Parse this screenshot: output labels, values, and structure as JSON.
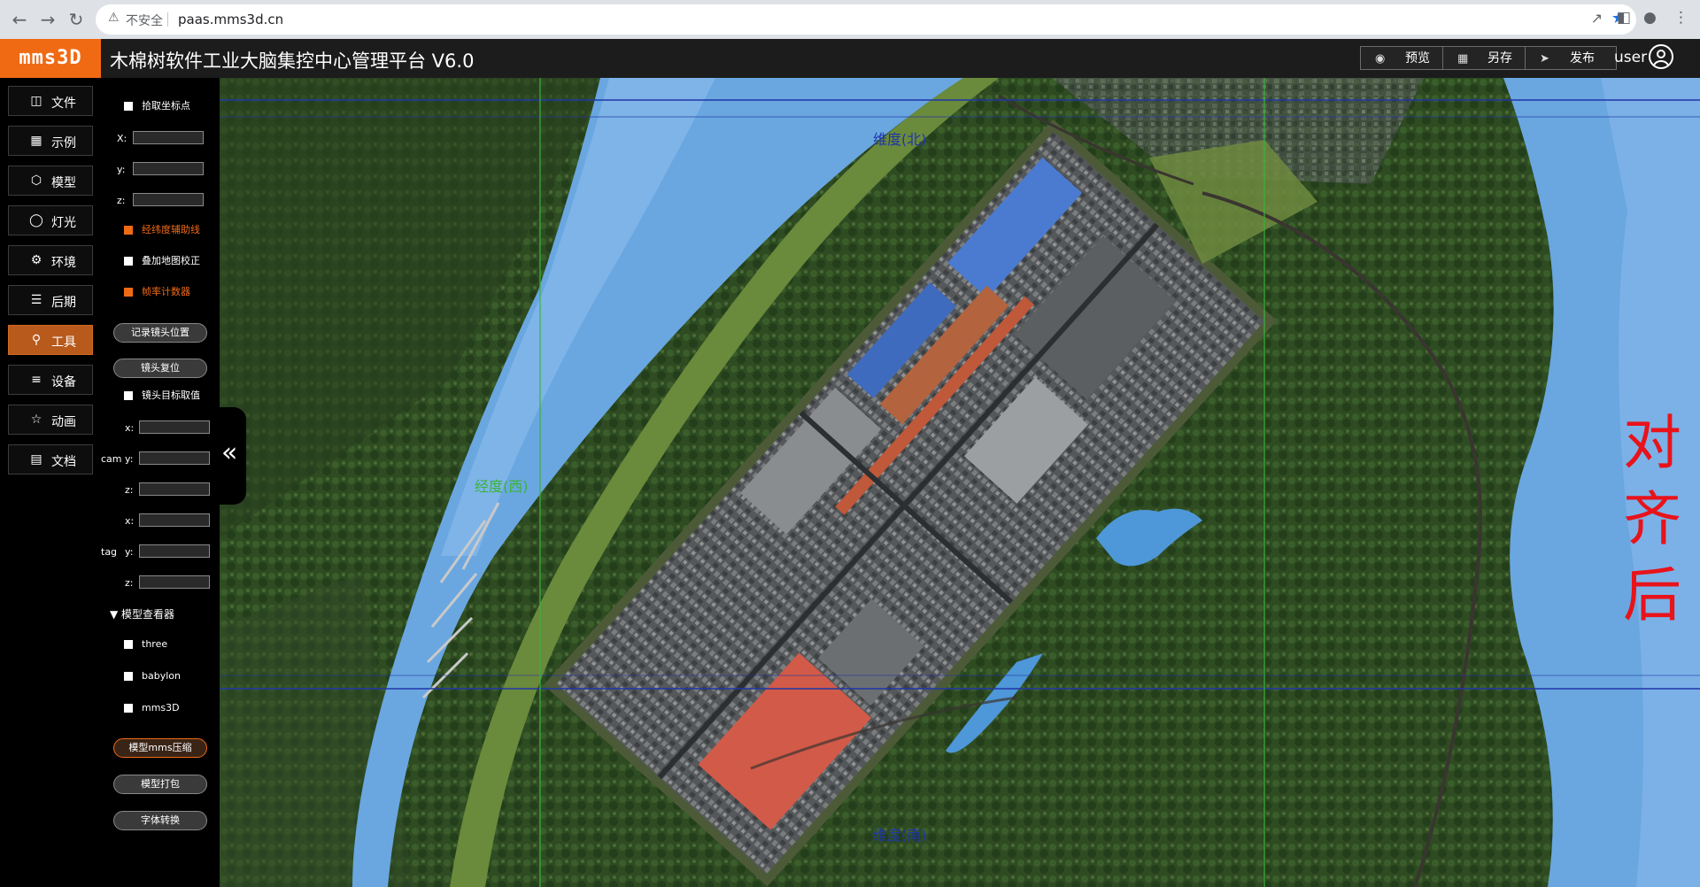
{
  "browser": {
    "security_label": "不安全",
    "url": "paas.mms3d.cn"
  },
  "app": {
    "logo": "mms3D",
    "title": "木棉树软件工业大脑集控中心管理平台 V6.0",
    "header_buttons": [
      {
        "label": "预览",
        "icon": "eye-icon"
      },
      {
        "label": "另存",
        "icon": "save-icon"
      },
      {
        "label": "发布",
        "icon": "send-icon"
      }
    ],
    "user": "user"
  },
  "menu": [
    {
      "label": "文件",
      "icon": "folder-icon"
    },
    {
      "label": "示例",
      "icon": "grid-icon"
    },
    {
      "label": "模型",
      "icon": "cube-icon"
    },
    {
      "label": "灯光",
      "icon": "bulb-icon"
    },
    {
      "label": "环境",
      "icon": "gear-icon"
    },
    {
      "label": "后期",
      "icon": "layers-icon"
    },
    {
      "label": "工具",
      "icon": "wrench-icon",
      "active": true
    },
    {
      "label": "设备",
      "icon": "list-icon"
    },
    {
      "label": "动画",
      "icon": "star-icon"
    },
    {
      "label": "文档",
      "icon": "document-icon"
    }
  ],
  "tools": {
    "pick_coord": {
      "label": "拾取坐标点",
      "checked": false
    },
    "coords": [
      {
        "label": "X:",
        "value": ""
      },
      {
        "label": "y:",
        "value": ""
      },
      {
        "label": "z:",
        "value": ""
      }
    ],
    "latlon_guides": {
      "label": "经纬度辅助线",
      "checked": true
    },
    "overlay_map": {
      "label": "叠加地图校正",
      "checked": false
    },
    "fps_counter": {
      "label": "帧率计数器",
      "checked": true
    },
    "record_camera": "记录镜头位置",
    "reset_camera": "镜头复位",
    "camera_target": {
      "label": "镜头目标取值",
      "checked": false
    },
    "cam_prefix": "cam",
    "tag_prefix": "tag",
    "cam_coords": [
      {
        "label": "x:",
        "value": ""
      },
      {
        "label": "y:",
        "value": ""
      },
      {
        "label": "z:",
        "value": ""
      }
    ],
    "tag_coords": [
      {
        "label": "x:",
        "value": ""
      },
      {
        "label": "y:",
        "value": ""
      },
      {
        "label": "z:",
        "value": ""
      }
    ],
    "viewer_title": "▼ 模型查看器",
    "viewers": [
      {
        "label": "three",
        "checked": false
      },
      {
        "label": "babylon",
        "checked": false
      },
      {
        "label": "mms3D",
        "checked": false
      }
    ],
    "compress": "模型mms压缩",
    "pack": "模型打包",
    "font_convert": "字体转换"
  },
  "view": {
    "lat_north": "维度(北)",
    "lat_south": "维度(南)",
    "lon_west": "经度(西)",
    "aligned": [
      "对",
      "齐",
      "后"
    ]
  },
  "colors": {
    "accent": "#f06a14",
    "lat_line": "#2036a8",
    "lon_line": "#3bb33b",
    "aligned_text": "#e8131b"
  }
}
